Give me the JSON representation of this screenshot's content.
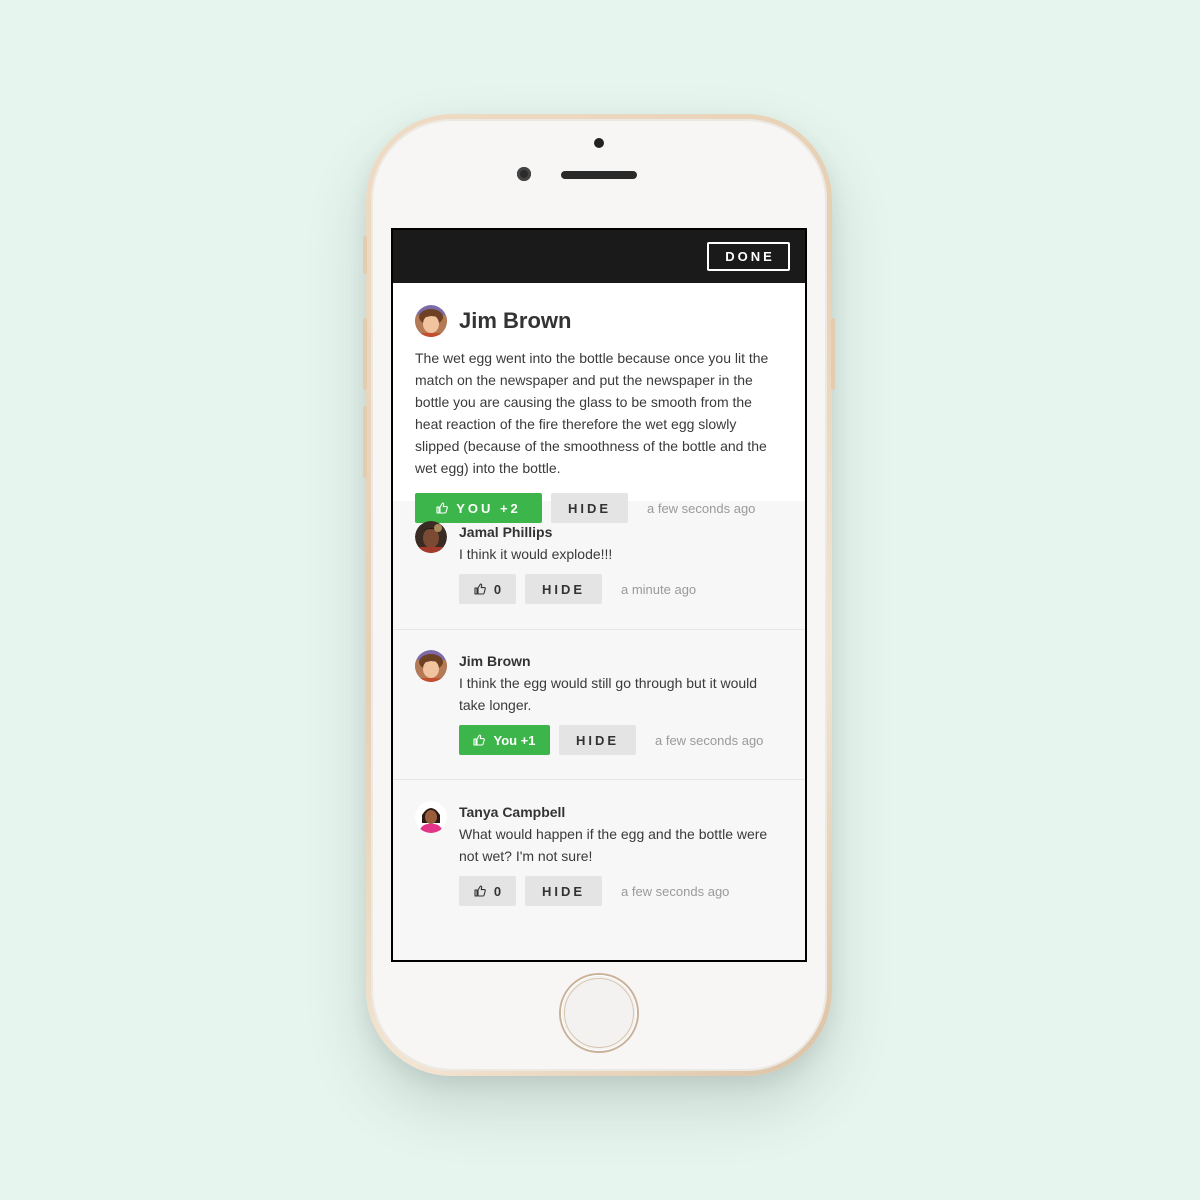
{
  "topbar": {
    "done_label": "DONE"
  },
  "main_post": {
    "author": "Jim Brown",
    "text": "The wet egg went into the bottle because once you lit the match on the newspaper and put the newspaper in the bottle you are causing the glass to be smooth from the heat reaction of the fire therefore the wet egg slowly slipped (because of the smoothness of the bottle and the wet egg) into the bottle.",
    "like_label": "YOU +2",
    "liked": true,
    "hide_label": "HIDE",
    "timestamp": "a few seconds ago"
  },
  "comments": [
    {
      "author": "Jamal Phillips",
      "text": "I think it would explode!!!",
      "like_label": "0",
      "liked": false,
      "hide_label": "HIDE",
      "timestamp": "a minute ago"
    },
    {
      "author": "Jim Brown",
      "text": "I think the egg would still go through but it would take longer.",
      "like_label": "You +1",
      "liked": true,
      "hide_label": "HIDE",
      "timestamp": "a few seconds ago"
    },
    {
      "author": "Tanya Campbell",
      "text": "What would happen if the egg and the bottle were not wet? I'm not sure!",
      "like_label": "0",
      "liked": false,
      "hide_label": "HIDE",
      "timestamp": "a few seconds ago"
    }
  ],
  "icons": {
    "like": "thumbs-up-icon"
  },
  "colors": {
    "accent_green": "#3cb54a",
    "topbar": "#1a1a1a",
    "background": "#e6f5ee"
  }
}
